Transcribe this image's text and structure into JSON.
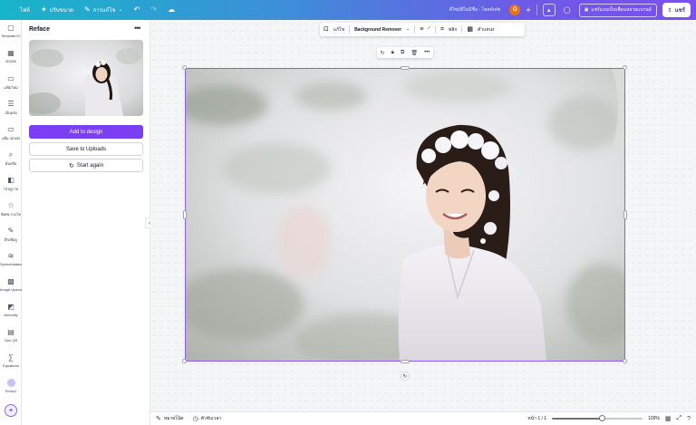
{
  "topbar": {
    "file_label": "ไฟล์",
    "resize_label": "ปรับขนาด",
    "edit_label": "การแก้ไข",
    "save_status": "ดีไซน์ที่ไม่มีชื่อ - โพสต์เฟซ",
    "avatar_letter": "G",
    "present_label": "แชร์แบบเป็นเพื่อนหลายแบรนด์",
    "share_label": "แชร์"
  },
  "rail": {
    "items": [
      {
        "label": "Template 67",
        "icon": "template-icon"
      },
      {
        "label": "3D456",
        "icon": "grid-icon"
      },
      {
        "label": "แฟ้มใหม่",
        "icon": "folder-icon"
      },
      {
        "label": "เส้นหลัง",
        "icon": "lines-icon"
      },
      {
        "label": "แฟ้ม 3D456",
        "icon": "folder-icon"
      },
      {
        "label": "ค้นหรือ",
        "icon": "search-icon"
      },
      {
        "label": "โปรดูภาพ",
        "icon": "photo-icon"
      },
      {
        "label": "พิเศษ กวงโซ",
        "icon": "star-icon"
      },
      {
        "label": "ฝึกเพื่อดู",
        "icon": "pen-icon"
      },
      {
        "label": "Speechmatics",
        "icon": "waves-icon"
      },
      {
        "label": "Image Upscaler",
        "icon": "upscale-icon"
      },
      {
        "label": "Animeify",
        "icon": "anime-icon"
      },
      {
        "label": "Gen QR",
        "icon": "qr-icon"
      },
      {
        "label": "Equations",
        "icon": "equation-icon"
      },
      {
        "label": "Reface",
        "icon": "reface-icon"
      }
    ]
  },
  "panel": {
    "title": "Reface",
    "add_to_design": "Add to design",
    "save_to_uploads": "Save to Uploads",
    "start_again": "Start again"
  },
  "context_toolbar": {
    "edit_label": "แก้ไข",
    "bg_remover_label": "Background Remover",
    "flip_label": "พลิก",
    "position_label": "ตำแหน่ง"
  },
  "bottombar": {
    "notes_label": "หมายโน้ต",
    "timer_label": "ตัวจับเวลา",
    "page_indicator": "หน้า 1 / 1",
    "zoom_level": "100%",
    "zoom_fraction": 0.55
  },
  "colors": {
    "accent": "#7a3ff2",
    "selection": "#8b5cf6"
  }
}
